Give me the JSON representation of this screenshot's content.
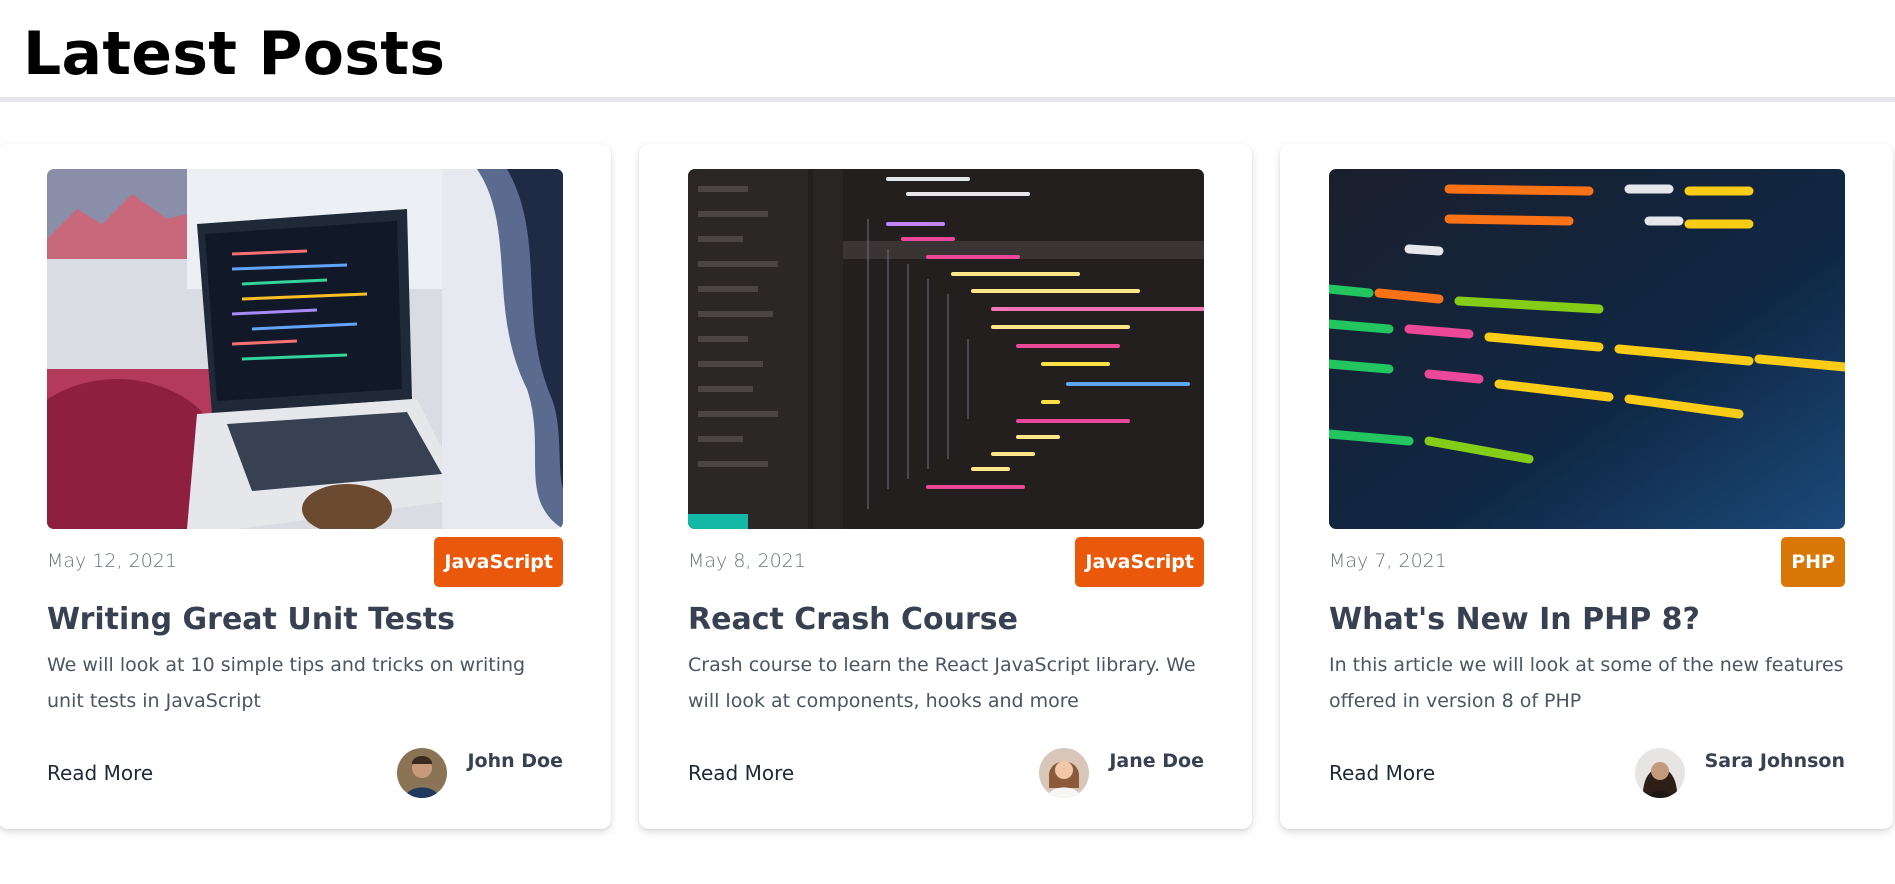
{
  "page": {
    "title": "Latest Posts"
  },
  "posts": [
    {
      "date": "May 12, 2021",
      "category": "JavaScript",
      "title": "Writing Great Unit Tests",
      "excerpt": "We will look at 10 simple tips and tricks on writing unit tests in JavaScript",
      "read_more": "Read More",
      "author": "John Doe",
      "badge_color": "#ea580c"
    },
    {
      "date": "May 8, 2021",
      "category": "JavaScript",
      "title": "React Crash Course",
      "excerpt": "Crash course to learn the React JavaScript library. We will look at components, hooks and more",
      "read_more": "Read More",
      "author": "Jane Doe",
      "badge_color": "#ea580c"
    },
    {
      "date": "May 7, 2021",
      "category": "PHP",
      "title": "What's New In PHP 8?",
      "excerpt": "In this article we will look at some of the new features offered in version 8 of PHP",
      "read_more": "Read More",
      "author": "Sara Johnson",
      "badge_color": "#d97706"
    }
  ]
}
